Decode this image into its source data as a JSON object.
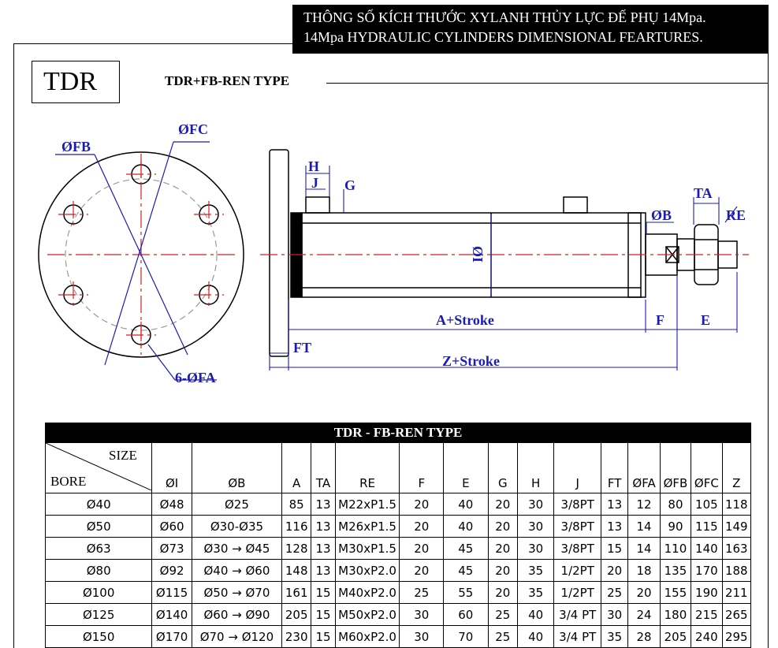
{
  "banner": {
    "line1": "THÔNG SỐ KÍCH THƯỚC XYLANH THỦY LỰC ĐẾ PHỤ 14Mpa.",
    "line2": "14Mpa HYDRAULIC  CYLINDERS DIMENSIONAL  FEARTURES."
  },
  "model_code": "TDR",
  "type_title": "TDR+FB-REN  TYPE",
  "drawing_labels": {
    "fb": "ØFB",
    "fc": "ØFC",
    "fa": "6-ØFA",
    "h": "H",
    "j": "J",
    "g": "G",
    "ta": "TA",
    "b": "ØB",
    "re": "RE",
    "i": "ØI",
    "a": "A+Stroke",
    "f": "F",
    "e": "E",
    "ft": "FT",
    "z": "Z+Stroke"
  },
  "colors": {
    "dimension": "#1b1bb5",
    "centerline": "#d42020",
    "banner": "#000000"
  },
  "table": {
    "title": "TDR - FB-REN TYPE",
    "size_label": "SIZE",
    "bore_label": "BORE",
    "headers": [
      "ØI",
      "ØB",
      "A",
      "TA",
      "RE",
      "F",
      "E",
      "G",
      "H",
      "J",
      "FT",
      "ØFA",
      "ØFB",
      "ØFC",
      "Z"
    ],
    "rows": [
      [
        "Ø40",
        "Ø48",
        "Ø25",
        "85",
        "13",
        "M22xP1.5",
        "20",
        "40",
        "20",
        "30",
        "3/8PT",
        "13",
        "12",
        "80",
        "105",
        "118"
      ],
      [
        "Ø50",
        "Ø60",
        "Ø30-Ø35",
        "116",
        "13",
        "M26xP1.5",
        "20",
        "40",
        "20",
        "30",
        "3/8PT",
        "13",
        "14",
        "90",
        "115",
        "149"
      ],
      [
        "Ø63",
        "Ø73",
        "Ø30 → Ø45",
        "128",
        "13",
        "M30xP1.5",
        "20",
        "45",
        "20",
        "30",
        "3/8PT",
        "15",
        "14",
        "110",
        "140",
        "163"
      ],
      [
        "Ø80",
        "Ø92",
        "Ø40 → Ø60",
        "148",
        "13",
        "M30xP2.0",
        "20",
        "45",
        "20",
        "35",
        "1/2PT",
        "20",
        "18",
        "135",
        "170",
        "188"
      ],
      [
        "Ø100",
        "Ø115",
        "Ø50 → Ø70",
        "161",
        "15",
        "M40xP2.0",
        "25",
        "55",
        "20",
        "35",
        "1/2PT",
        "25",
        "20",
        "155",
        "190",
        "211"
      ],
      [
        "Ø125",
        "Ø140",
        "Ø60 → Ø90",
        "205",
        "15",
        "M50xP2.0",
        "30",
        "60",
        "25",
        "40",
        "3/4 PT",
        "30",
        "24",
        "180",
        "215",
        "265"
      ],
      [
        "Ø150",
        "Ø170",
        "Ø70 → Ø120",
        "230",
        "15",
        "M60xP2.0",
        "30",
        "70",
        "25",
        "40",
        "3/4 PT",
        "35",
        "28",
        "205",
        "240",
        "295"
      ]
    ]
  }
}
